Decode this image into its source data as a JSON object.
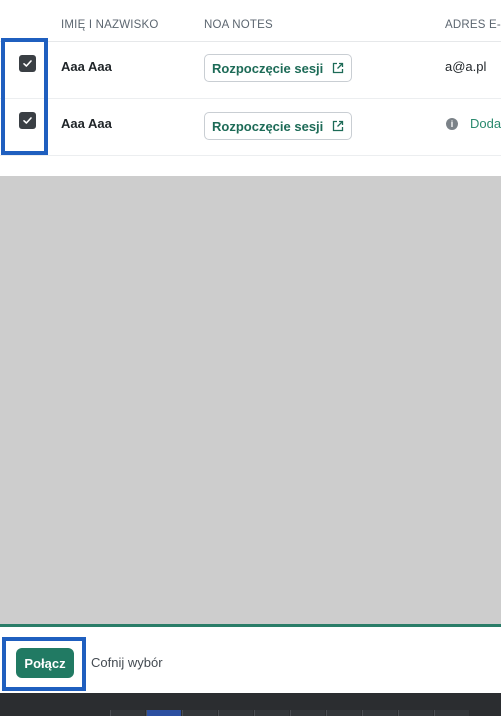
{
  "table": {
    "headers": {
      "name": "IMIĘ I NAZWISKO",
      "notes": "NOA NOTES",
      "email": "ADRES E-M"
    },
    "rows": [
      {
        "checked": true,
        "name": "Aaa Aaa",
        "session_label": "Rozpoczęcie sesji",
        "email": "a@a.pl"
      },
      {
        "checked": true,
        "name": "Aaa Aaa",
        "session_label": "Rozpoczęcie sesji",
        "add_label": "Doda"
      }
    ]
  },
  "actions": {
    "connect_label": "Połącz",
    "undo_label": "Cofnij wybór"
  },
  "colors": {
    "accent": "#217a63",
    "link": "#2a8a6e",
    "highlight": "#1f5fbf",
    "empty_area": "#cdcdcd"
  },
  "icons": {
    "checkbox": "check-icon",
    "external": "external-link-icon",
    "info": "info-icon"
  }
}
